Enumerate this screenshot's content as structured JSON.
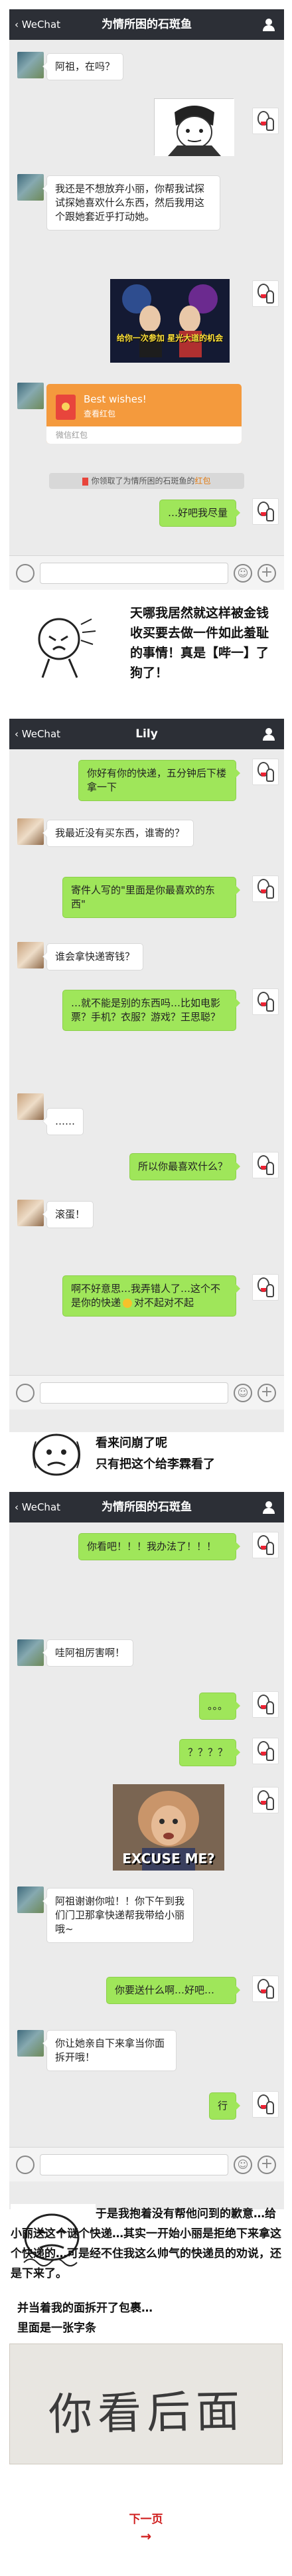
{
  "screen1": {
    "back": "WeChat",
    "title": "为情所困的石斑鱼",
    "msg1": "阿祖，在吗？",
    "msg2": "我还是不想放弃小丽，你帮我试探试探她喜欢什么东西，然后我用这个跟她套近乎打动她。",
    "video_caption": "给你一次参加 星光大道的机会",
    "redpacket_wishes": "Best wishes!",
    "redpacket_view": "查看红包",
    "redpacket_footer": "微信红包",
    "system_tip_prefix": "你领取了",
    "system_tip_name": "为情所困的石斑鱼",
    "system_tip_suffix": "的",
    "system_tip_link": "红包",
    "msg3": "…好吧我尽量"
  },
  "narration1": "天哪我居然就这样被金钱收买要去做一件如此羞耻的事情！真是【哔一】了狗了！",
  "screen2": {
    "back": "WeChat",
    "title": "Lily",
    "msgs": [
      "你好有你的快递，五分钟后下楼拿一下",
      "我最近没有买东西，谁寄的？",
      "寄件人写的\"里面是你最喜欢的东西\"",
      "谁会拿快递寄钱？",
      "…就不能是别的东西吗…比如电影票？手机？衣服？游戏？王思聪？",
      "……",
      "所以你最喜欢什么？",
      "滚蛋！",
      "啊不好意思…我弄错人了…这个不是你的快递",
      "对不起对不起"
    ]
  },
  "narration2_line1": "看来问崩了呢",
  "narration2_line2": "只有把这个给李霖看了",
  "screen3": {
    "back": "WeChat",
    "title": "为情所困的石斑鱼",
    "msgs": [
      "你看吧！！！我办法了！！！",
      "哇阿祖厉害啊！",
      "。。。",
      "？？？？",
      "阿祖谢谢你啦！！你下午到我们门卫那拿快递帮我带给小丽哦~",
      "你要送什么啊…好吧…",
      "你让她亲自下来拿当你面拆开哦！",
      "行"
    ],
    "excuse_text": "EXCUSE ME?"
  },
  "narration3": "于是我抱着没有帮他问到的歉意…给小丽送这个谜个快递…其实一开始小丽是拒绝下来拿这个快递的…可是经不住我这么帅气的快递员的劝说，还是下来了。",
  "narration4_line1": "并当着我的面拆开了包裹…",
  "narration4_line2": "里面是一张字条",
  "note_text": "你看后面",
  "next_page": "下一页",
  "next_arrow": "→",
  "colors": {
    "topbar": "#2c2f36",
    "chat_bg": "#ebebeb",
    "bubble_right": "#9fe65a",
    "redpacket": "#f49a3d",
    "link_red": "#d02020"
  }
}
